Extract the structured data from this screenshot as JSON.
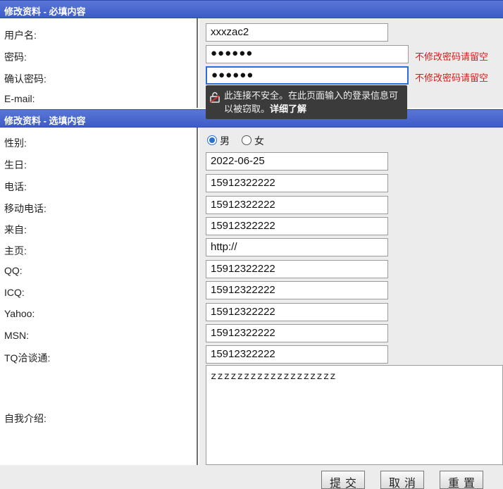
{
  "sections": {
    "required_title": "修改资料 - 必填内容",
    "optional_title": "修改资料 - 选填内容"
  },
  "fields": {
    "username": {
      "label": "用户名:",
      "value": "xxxzac2"
    },
    "password": {
      "label": "密码:",
      "value": "●●●●●●",
      "hint": "不修改密码请留空"
    },
    "confirm_password": {
      "label": "确认密码:",
      "value": "●●●●●●",
      "hint": "不修改密码请留空"
    },
    "email": {
      "label": "E-mail:"
    },
    "gender": {
      "label": "性别:",
      "options": [
        "男",
        "女"
      ],
      "selected": "男"
    },
    "birthday": {
      "label": "生日:",
      "value": "2022-06-25"
    },
    "phone": {
      "label": "电话:",
      "value": "15912322222"
    },
    "mobile": {
      "label": "移动电话:",
      "value": "15912322222"
    },
    "from": {
      "label": "来自:",
      "value": "15912322222"
    },
    "homepage": {
      "label": "主页:",
      "value": "http://"
    },
    "qq": {
      "label": "QQ:",
      "value": "15912322222"
    },
    "icq": {
      "label": "ICQ:",
      "value": "15912322222"
    },
    "yahoo": {
      "label": "Yahoo:",
      "value": "15912322222"
    },
    "msn": {
      "label": "MSN:",
      "value": "15912322222"
    },
    "tq": {
      "label": "TQ洽谈通:",
      "value": "15912322222"
    },
    "intro": {
      "label": "自我介绍:",
      "value": "zzzzzzzzzzzzzzzzzzz"
    }
  },
  "tooltip": {
    "text": "此连接不安全。在此页面输入的登录信息可以被窃取。",
    "more": "详细了解"
  },
  "buttons": {
    "submit": "提交",
    "cancel": "取消",
    "reset": "重置"
  },
  "colors": {
    "header_blue": "#3e5cc8",
    "hint_red": "#e01818",
    "focus_blue": "#2a6fd6"
  }
}
